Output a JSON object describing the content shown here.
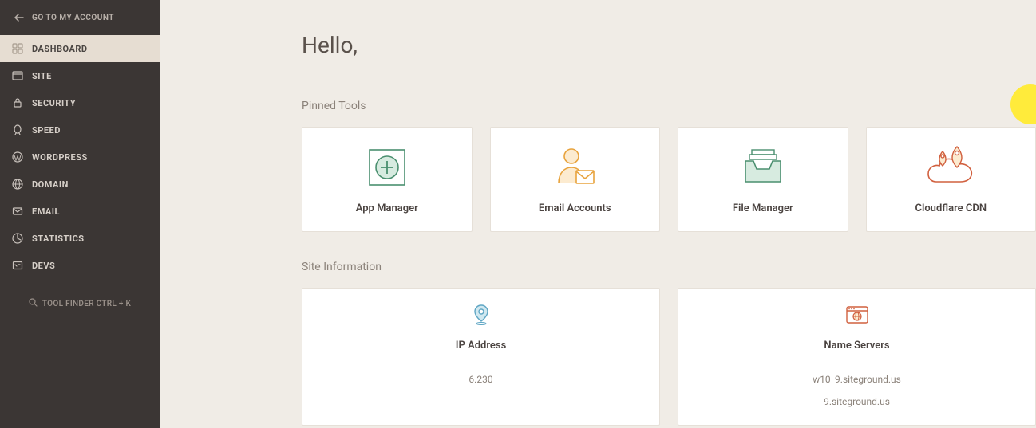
{
  "back_link": "GO TO MY ACCOUNT",
  "nav": [
    {
      "label": "DASHBOARD",
      "icon": "dashboard-icon",
      "active": true
    },
    {
      "label": "SITE",
      "icon": "site-icon"
    },
    {
      "label": "SECURITY",
      "icon": "lock-icon"
    },
    {
      "label": "SPEED",
      "icon": "rocket-icon"
    },
    {
      "label": "WORDPRESS",
      "icon": "wordpress-icon"
    },
    {
      "label": "DOMAIN",
      "icon": "globe-icon"
    },
    {
      "label": "EMAIL",
      "icon": "envelope-icon"
    },
    {
      "label": "STATISTICS",
      "icon": "stats-icon"
    },
    {
      "label": "DEVS",
      "icon": "devs-icon"
    }
  ],
  "tool_finder": "TOOL FINDER CTRL + K",
  "greeting": "Hello,",
  "pinned_title": "Pinned Tools",
  "pinned": [
    {
      "label": "App Manager",
      "icon": "app-manager-icon"
    },
    {
      "label": "Email Accounts",
      "icon": "email-accounts-icon"
    },
    {
      "label": "File Manager",
      "icon": "file-manager-icon"
    },
    {
      "label": "Cloudflare CDN",
      "icon": "cdn-icon"
    }
  ],
  "site_info_title": "Site Information",
  "site_info": {
    "ip_title": "IP Address",
    "ip_value": "6.230",
    "ns_title": "Name Servers",
    "ns_values": [
      "w10_9.siteground.us",
      "9.siteground.us"
    ]
  }
}
